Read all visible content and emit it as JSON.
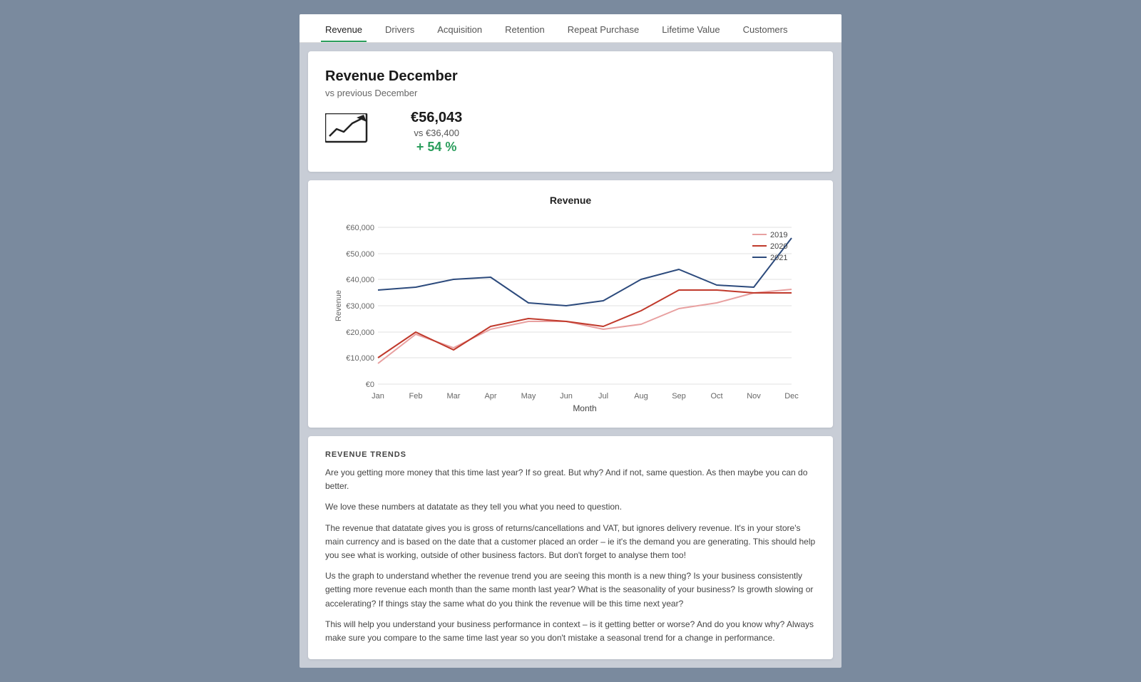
{
  "nav": {
    "items": [
      {
        "label": "Revenue",
        "active": true
      },
      {
        "label": "Drivers",
        "active": false
      },
      {
        "label": "Acquisition",
        "active": false
      },
      {
        "label": "Retention",
        "active": false
      },
      {
        "label": "Repeat Purchase",
        "active": false
      },
      {
        "label": "Lifetime Value",
        "active": false
      },
      {
        "label": "Customers",
        "active": false
      }
    ]
  },
  "revenue_header": {
    "title": "Revenue December",
    "subtitle": "vs previous December",
    "main_value": "€56,043",
    "vs_value": "vs €36,400",
    "pct_change": "+ 54 %"
  },
  "chart": {
    "title": "Revenue",
    "x_label": "Month",
    "y_label": "Revenue",
    "x_ticks": [
      "Jan",
      "Feb",
      "Mar",
      "Apr",
      "May",
      "Jun",
      "Jul",
      "Aug",
      "Sep",
      "Oct",
      "Nov",
      "Dec"
    ],
    "y_ticks": [
      "€0",
      "€10,000",
      "€20,000",
      "€30,000",
      "€40,000",
      "€50,000",
      "€60,000"
    ],
    "legend": [
      {
        "label": "2019",
        "color": "#e05a5a"
      },
      {
        "label": "2020",
        "color": "#c0392b"
      },
      {
        "label": "2021",
        "color": "#2c4a7c"
      }
    ]
  },
  "revenue_trends": {
    "section_label": "REVENUE TRENDS",
    "paragraphs": [
      "Are you getting more money that this time last year? If so great. But why? And if not, same question. As then maybe you can do better.",
      "We love these numbers at datatate as they tell you what you need to question.",
      "The revenue that datatate gives you is gross of returns/cancellations and VAT, but ignores delivery revenue. It's in your store's main currency and is based on the date that a customer placed an order – ie it's the demand you are generating. This should help you see what is working, outside of other business factors. But don't forget to analyse them too!",
      "Us the graph to understand whether the revenue trend you are seeing this month is a new thing? Is your business consistently getting more revenue each month than the same month last year? What is the seasonality of your business? Is growth slowing or accelerating? If things stay the same what do you think the revenue will be this time next year?",
      "This will help you understand your business performance in context – is it getting better or worse? And do you know why? Always make sure you compare to the same time last year so you don't mistake a seasonal trend for a change in performance."
    ]
  }
}
